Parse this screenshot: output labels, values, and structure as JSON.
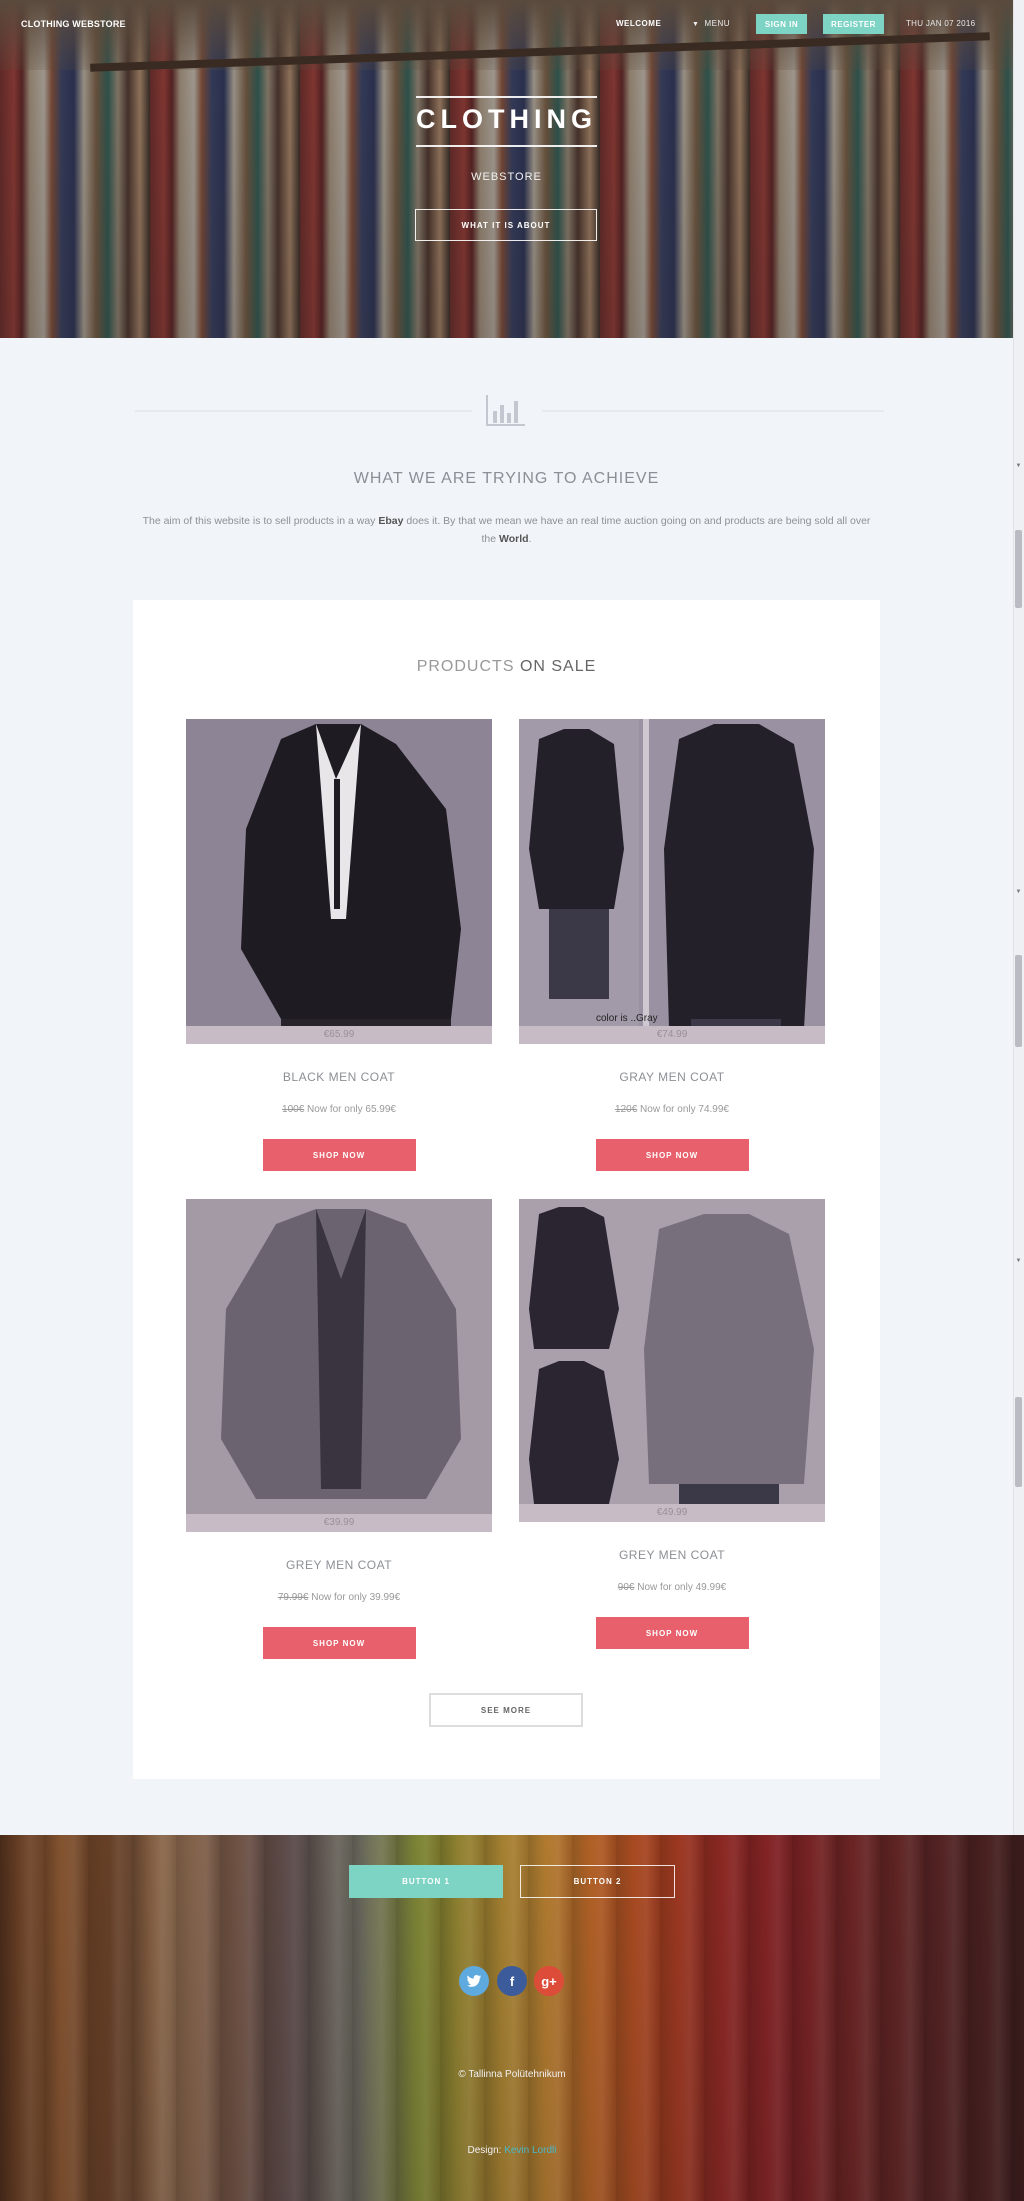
{
  "header": {
    "brand": "CLOTHING WEBSTORE",
    "nav": {
      "welcome": "WELCOME",
      "menu": "MENU",
      "sign_in": "SIGN IN",
      "register": "REGISTER",
      "date": "THU JAN 07 2016"
    }
  },
  "hero": {
    "title": "CLOTHING",
    "subtitle": "WEBSTORE",
    "button": "WHAT IT IS ABOUT"
  },
  "achieve": {
    "title": "WHAT WE ARE TRYING TO ACHIEVE",
    "text_1": "The aim of this website is to sell products in a way ",
    "text_bold_1": "Ebay",
    "text_2": " does it. By that we mean we have an real time auction going on and products are being sold all over the ",
    "text_bold_2": "World",
    "text_3": "."
  },
  "products_section": {
    "title_light": "PRODUCTS ",
    "title_strong": "ON SALE",
    "see_more": "SEE MORE",
    "items": [
      {
        "name": "BLACK MEN COAT",
        "strip_price": "€65.99",
        "old_price": "100€",
        "now_text": " Now for only 65.99€",
        "button": "SHOP NOW"
      },
      {
        "name": "GRAY MEN COAT",
        "strip_price": "€74.99",
        "old_price": "120€",
        "now_text": " Now for only 74.99€",
        "button": "SHOP NOW",
        "image_caption": "color is ..Gray"
      },
      {
        "name": "GREY MEN COAT",
        "strip_price": "€39.99",
        "old_price": "79.99€",
        "now_text": " Now for only 39.99€",
        "button": "SHOP NOW"
      },
      {
        "name": "GREY MEN COAT",
        "strip_price": "€49.99",
        "old_price": "90€",
        "now_text": " Now for only 49.99€",
        "button": "SHOP NOW"
      }
    ]
  },
  "footer": {
    "button_1": "BUTTON 1",
    "button_2": "BUTTON 2",
    "social": {
      "twitter": "twitter-icon",
      "facebook": "facebook-icon",
      "googleplus": "google-plus-icon"
    },
    "copyright": "© Tallinna Polütehnikum",
    "design_label": "Design: ",
    "design_link": "Kevin Lordli"
  }
}
